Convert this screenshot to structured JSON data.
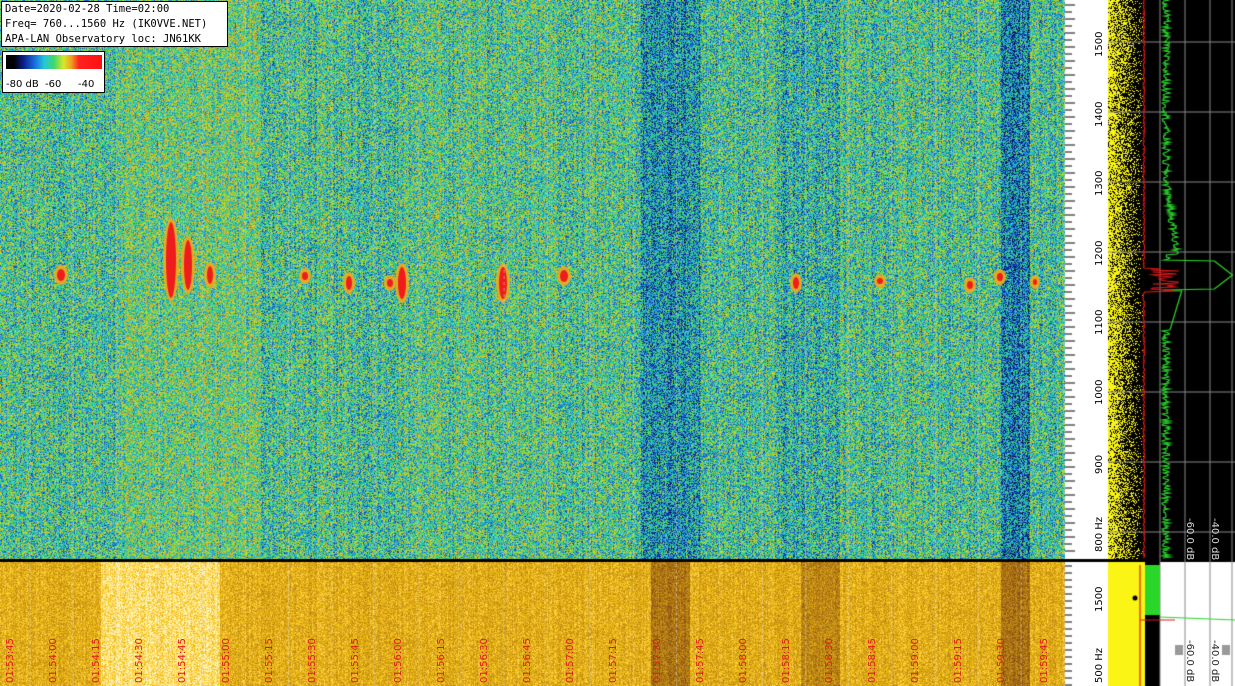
{
  "header": {
    "line1": "Date=2020-02-28 Time=02:00",
    "line2": "Freq= 760...1560 Hz (IK0VVE.NET)",
    "line3": "APA-LAN Observatory loc: JN61KK"
  },
  "color_scale": {
    "labels": [
      "-80 dB",
      "-60",
      "-40"
    ],
    "colors": [
      "#000000",
      "#0b1c8a",
      "#1a6ee0",
      "#25c7d8",
      "#3ed86a",
      "#d8e82a",
      "#f0a020",
      "#ff2020"
    ]
  },
  "freq_axis_top": {
    "ticks": [
      "1500",
      "1400",
      "1300",
      "1200",
      "1100",
      "1000",
      "900",
      "800 Hz"
    ]
  },
  "freq_axis_bottom": {
    "ticks": [
      "1500",
      "500 Hz"
    ]
  },
  "time_axis": {
    "labels": [
      "01:53:45",
      "01:54:00",
      "01:54:15",
      "01:54:30",
      "01:54:45",
      "01:55:00",
      "01:55:15",
      "01:55:30",
      "01:55:45",
      "01:56:00",
      "01:56:15",
      "01:56:30",
      "01:56:45",
      "01:57:00",
      "01:57:15",
      "01:57:30",
      "01:57:45",
      "01:58:00",
      "01:58:15",
      "01:58:30",
      "01:58:45",
      "01:59:00",
      "01:59:15",
      "01:59:30",
      "01:59:45"
    ]
  },
  "spectrum_panel": {
    "db_labels_top": [
      "-60.0 dB",
      "-40.0 dB"
    ],
    "db_labels_bottom": [
      "-60.0 dB",
      "-40.0 dB"
    ]
  }
}
